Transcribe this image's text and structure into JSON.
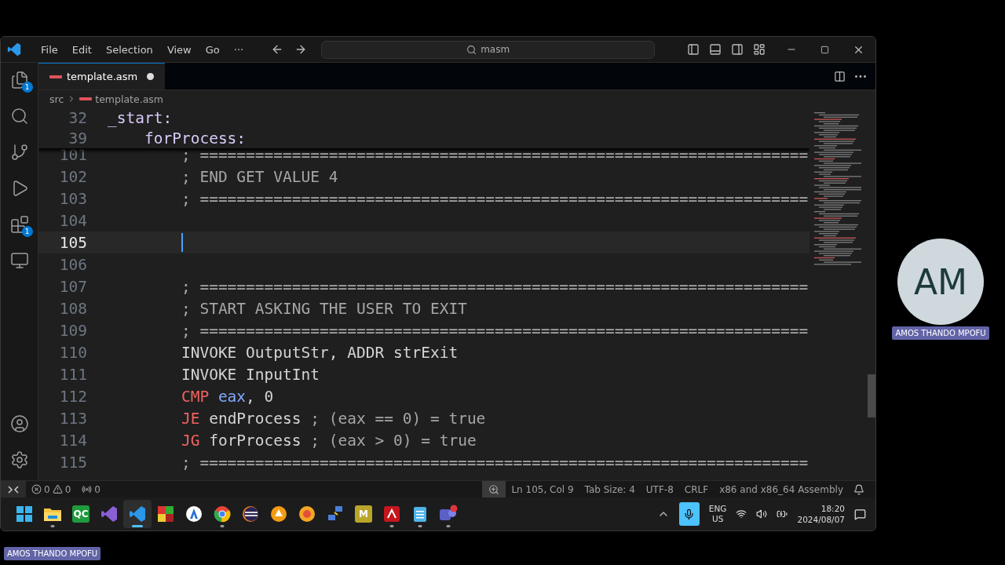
{
  "window": {
    "menu": [
      "File",
      "Edit",
      "Selection",
      "View",
      "Go",
      "···"
    ],
    "search": {
      "value": "masm"
    }
  },
  "activity_bar": {
    "top": [
      {
        "kind": "explorer",
        "badge": "1"
      },
      {
        "kind": "search"
      },
      {
        "kind": "source-control"
      },
      {
        "kind": "run"
      },
      {
        "kind": "extensions",
        "badge": "1"
      },
      {
        "kind": "remote"
      }
    ],
    "bottom": [
      {
        "kind": "account"
      },
      {
        "kind": "settings"
      }
    ]
  },
  "tabs": [
    {
      "label": "template.asm",
      "selected": true,
      "modified": true
    }
  ],
  "breadcrumb": [
    "src",
    "template.asm"
  ],
  "sticky_lines": [
    {
      "number": "32",
      "tokens": [
        {
          "kind": "label",
          "text": "_start:"
        }
      ]
    },
    {
      "number": "39",
      "tokens": [
        {
          "kind": "label",
          "text": "    forProcess:"
        }
      ]
    }
  ],
  "lines": [
    {
      "number": "101",
      "active": false,
      "tokens": [
        {
          "kind": "comment",
          "text": "        ; =================================================================="
        }
      ]
    },
    {
      "number": "102",
      "active": false,
      "tokens": [
        {
          "kind": "comment",
          "text": "        ; END GET VALUE 4"
        }
      ]
    },
    {
      "number": "103",
      "active": false,
      "tokens": [
        {
          "kind": "comment",
          "text": "        ; =================================================================="
        }
      ]
    },
    {
      "number": "104",
      "active": false
    },
    {
      "number": "105",
      "active": true
    },
    {
      "number": "106",
      "active": false
    },
    {
      "number": "107",
      "active": false,
      "tokens": [
        {
          "kind": "comment",
          "text": "        ; =================================================================="
        }
      ]
    },
    {
      "number": "108",
      "active": false,
      "tokens": [
        {
          "kind": "comment",
          "text": "        ; START ASKING THE USER TO EXIT"
        }
      ]
    },
    {
      "number": "109",
      "active": false,
      "tokens": [
        {
          "kind": "comment",
          "text": "        ; =================================================================="
        }
      ]
    },
    {
      "number": "110",
      "active": false,
      "tokens": [
        {
          "kind": "text",
          "text": "        INVOKE OutputStr, ADDR strExit"
        }
      ]
    },
    {
      "number": "111",
      "active": false,
      "tokens": [
        {
          "kind": "text",
          "text": "        INVOKE InputInt"
        }
      ]
    },
    {
      "number": "112",
      "active": false,
      "tokens": [
        {
          "kind": "keyword",
          "text": "        CMP"
        },
        {
          "kind": "register",
          "text": " eax"
        },
        {
          "kind": "text",
          "text": ", 0"
        }
      ]
    },
    {
      "number": "113",
      "active": false,
      "tokens": [
        {
          "kind": "keyword",
          "text": "        JE"
        },
        {
          "kind": "text",
          "text": " endProcess "
        },
        {
          "kind": "comment",
          "text": "; (eax == 0) = true"
        }
      ]
    },
    {
      "number": "114",
      "active": false,
      "tokens": [
        {
          "kind": "keyword",
          "text": "        JG"
        },
        {
          "kind": "text",
          "text": " forProcess "
        },
        {
          "kind": "comment",
          "text": "; (eax > 0) = true"
        }
      ]
    },
    {
      "number": "115",
      "active": false,
      "tokens": [
        {
          "kind": "comment",
          "text": "        ; =================================================================="
        }
      ]
    }
  ],
  "status_bar": {
    "errors": "0",
    "warnings": "0",
    "ports": "0",
    "items": [
      "Ln 105, Col 9",
      "Tab Size: 4",
      "UTF-8",
      "CRLF",
      "x86 and x86_64 Assembly"
    ]
  },
  "taskbar": {
    "items": [
      {
        "kind": "start",
        "selected": false,
        "running": false
      },
      {
        "kind": "folder",
        "selected": false,
        "running": true
      },
      {
        "kind": "tile",
        "label": "QC",
        "color": "#1f9a3c",
        "selected": false,
        "running": false
      },
      {
        "kind": "vs",
        "selected": false,
        "running": false
      },
      {
        "kind": "vscode",
        "selected": true,
        "running": true
      },
      {
        "kind": "blocks",
        "selected": false,
        "running": false
      },
      {
        "kind": "circle-a",
        "selected": false,
        "running": false
      },
      {
        "kind": "chrome",
        "selected": false,
        "running": true
      },
      {
        "kind": "eclipse",
        "selected": false,
        "running": false
      },
      {
        "kind": "orange-a",
        "selected": false,
        "running": false
      },
      {
        "kind": "orange-b",
        "selected": false,
        "running": false
      },
      {
        "kind": "network",
        "selected": false,
        "running": false
      },
      {
        "kind": "tile",
        "label": "M",
        "color": "#b9a52a",
        "selected": false,
        "running": false
      },
      {
        "kind": "pdf",
        "selected": false,
        "running": true
      },
      {
        "kind": "notepad",
        "selected": false,
        "running": true
      },
      {
        "kind": "teams",
        "selected": false,
        "running": true
      }
    ],
    "tray": {
      "mic_on": true,
      "language": "ENG",
      "region": "US",
      "time": "18:20",
      "date": "2024/08/07"
    }
  },
  "participant": {
    "initials": "AM",
    "name": "AMOS THANDO MPOFU"
  },
  "presenter_tag": "AMOS THANDO MPOFU"
}
